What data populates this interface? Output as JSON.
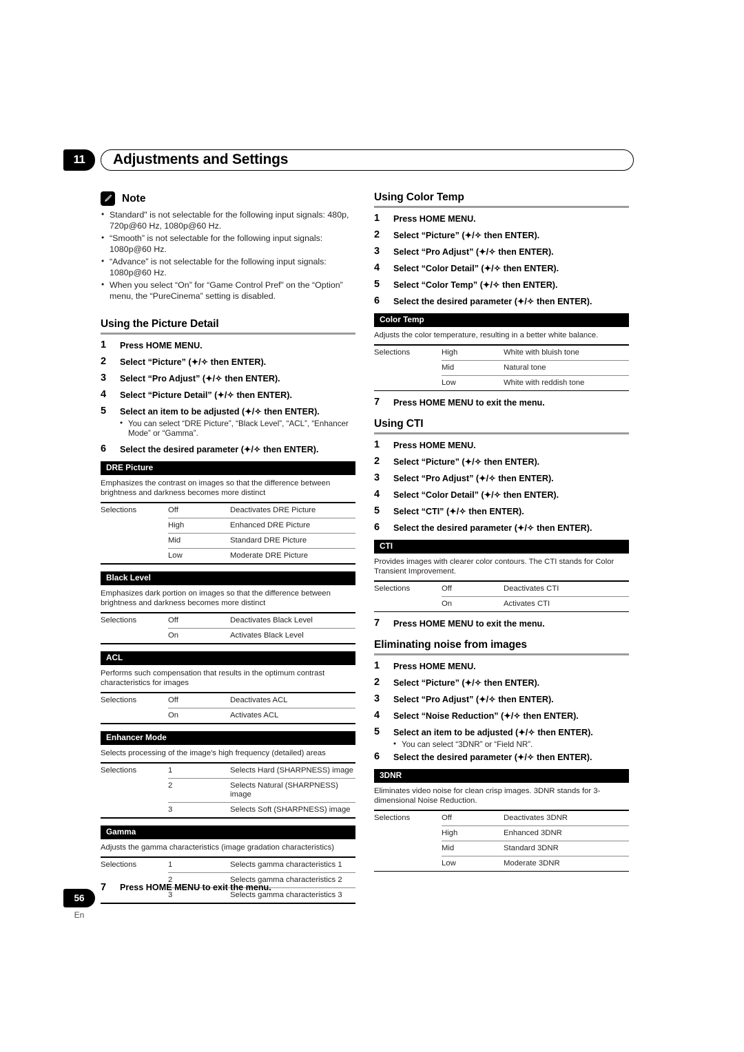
{
  "chapter": {
    "number": "11",
    "title": "Adjustments and Settings"
  },
  "note": {
    "icon": "pencil-note-icon",
    "label": "Note",
    "bullets": [
      "Standard\" is not selectable for the following input signals: 480p, 720p@60 Hz, 1080p@60 Hz.",
      "“Smooth” is not selectable for the following input signals: 1080p@60 Hz.",
      "“Advance” is not selectable for the following input signals: 1080p@60 Hz.",
      "When you select “On” for “Game Control Pref” on the “Option” menu, the “PureCinema” setting is disabled."
    ]
  },
  "sections": {
    "picture_detail": {
      "heading": "Using the Picture Detail",
      "steps": [
        {
          "num": "1",
          "text": "Press HOME MENU."
        },
        {
          "num": "2",
          "text": "Select “Picture” (✦/✧ then ENTER)."
        },
        {
          "num": "3",
          "text": "Select “Pro Adjust” (✦/✧ then ENTER)."
        },
        {
          "num": "4",
          "text": "Select “Picture Detail” (✦/✧ then ENTER)."
        },
        {
          "num": "5",
          "text": "Select an item to be adjusted (✦/✧ then ENTER).",
          "sub": [
            "You can select “DRE Picture”, “Black Level”, “ACL”, “Enhancer Mode” or “Gamma”."
          ]
        },
        {
          "num": "6",
          "text": "Select the desired parameter (✦/✧ then ENTER)."
        }
      ],
      "final_step": {
        "num": "7",
        "text": "Press HOME MENU to exit the menu."
      }
    },
    "color_temp": {
      "heading": "Using Color Temp",
      "steps": [
        {
          "num": "1",
          "text": "Press HOME MENU."
        },
        {
          "num": "2",
          "text": "Select “Picture” (✦/✧ then ENTER)."
        },
        {
          "num": "3",
          "text": "Select “Pro Adjust” (✦/✧ then ENTER)."
        },
        {
          "num": "4",
          "text": "Select “Color Detail” (✦/✧ then ENTER)."
        },
        {
          "num": "5",
          "text": "Select “Color Temp” (✦/✧ then ENTER)."
        },
        {
          "num": "6",
          "text": "Select the desired parameter (✦/✧ then ENTER)."
        }
      ],
      "final_step": {
        "num": "7",
        "text": "Press HOME MENU to exit the menu."
      }
    },
    "cti": {
      "heading": "Using CTI",
      "steps": [
        {
          "num": "1",
          "text": "Press HOME MENU."
        },
        {
          "num": "2",
          "text": "Select “Picture” (✦/✧ then ENTER)."
        },
        {
          "num": "3",
          "text": "Select “Pro Adjust” (✦/✧ then ENTER)."
        },
        {
          "num": "4",
          "text": "Select “Color Detail” (✦/✧ then ENTER)."
        },
        {
          "num": "5",
          "text": "Select “CTI” (✦/✧ then ENTER)."
        },
        {
          "num": "6",
          "text": "Select the desired parameter (✦/✧ then ENTER)."
        }
      ],
      "final_step": {
        "num": "7",
        "text": "Press HOME MENU to exit the menu."
      }
    },
    "noise": {
      "heading": "Eliminating noise from images",
      "steps": [
        {
          "num": "1",
          "text": "Press HOME MENU."
        },
        {
          "num": "2",
          "text": "Select “Picture” (✦/✧ then ENTER)."
        },
        {
          "num": "3",
          "text": "Select “Pro Adjust” (✦/✧ then ENTER)."
        },
        {
          "num": "4",
          "text": "Select “Noise Reduction” (✦/✧ then ENTER)."
        },
        {
          "num": "5",
          "text": "Select an item to be adjusted (✦/✧ then ENTER).",
          "sub": [
            "You can select “3DNR” or “Field NR”."
          ]
        },
        {
          "num": "6",
          "text": "Select the desired parameter (✦/✧ then ENTER)."
        }
      ]
    }
  },
  "tables": {
    "dre_picture": {
      "title": "DRE Picture",
      "description": "Emphasizes the contrast on images so that the difference between brightness and darkness becomes more distinct",
      "selections_label": "Selections",
      "rows": [
        {
          "value": "Off",
          "desc": "Deactivates DRE Picture"
        },
        {
          "value": "High",
          "desc": "Enhanced DRE Picture"
        },
        {
          "value": "Mid",
          "desc": "Standard DRE Picture"
        },
        {
          "value": "Low",
          "desc": "Moderate DRE Picture"
        }
      ]
    },
    "black_level": {
      "title": "Black Level",
      "description": "Emphasizes dark portion on images so that the difference between brightness and darkness becomes more distinct",
      "selections_label": "Selections",
      "rows": [
        {
          "value": "Off",
          "desc": "Deactivates Black Level"
        },
        {
          "value": "On",
          "desc": "Activates Black Level"
        }
      ]
    },
    "acl": {
      "title": "ACL",
      "description": "Performs such compensation that results in the optimum contrast characteristics for images",
      "selections_label": "Selections",
      "rows": [
        {
          "value": "Off",
          "desc": "Deactivates ACL"
        },
        {
          "value": "On",
          "desc": "Activates ACL"
        }
      ]
    },
    "enhancer_mode": {
      "title": "Enhancer Mode",
      "description": "Selects processing of the image's high frequency (detailed) areas",
      "selections_label": "Selections",
      "rows": [
        {
          "value": "1",
          "desc": "Selects Hard (SHARPNESS) image"
        },
        {
          "value": "2",
          "desc": "Selects Natural (SHARPNESS) image"
        },
        {
          "value": "3",
          "desc": "Selects Soft (SHARPNESS) image"
        }
      ]
    },
    "gamma": {
      "title": "Gamma",
      "description": "Adjusts the gamma characteristics (image gradation characteristics)",
      "selections_label": "Selections",
      "rows": [
        {
          "value": "1",
          "desc": "Selects gamma characteristics 1"
        },
        {
          "value": "2",
          "desc": "Selects gamma characteristics 2"
        },
        {
          "value": "3",
          "desc": "Selects gamma characteristics 3"
        }
      ]
    },
    "color_temp": {
      "title": "Color Temp",
      "description": "Adjusts the color temperature, resulting in a better white balance.",
      "selections_label": "Selections",
      "rows": [
        {
          "value": "High",
          "desc": "White with bluish tone"
        },
        {
          "value": "Mid",
          "desc": "Natural tone"
        },
        {
          "value": "Low",
          "desc": "White with reddish tone"
        }
      ]
    },
    "cti": {
      "title": "CTI",
      "description": "Provides images with clearer color contours. The CTI stands for Color Transient Improvement.",
      "selections_label": "Selections",
      "rows": [
        {
          "value": "Off",
          "desc": "Deactivates CTI"
        },
        {
          "value": "On",
          "desc": "Activates CTI"
        }
      ]
    },
    "3dnr": {
      "title": "3DNR",
      "description": "Eliminates video noise for clean crisp images. 3DNR stands for 3-dimensional Noise Reduction.",
      "selections_label": "Selections",
      "rows": [
        {
          "value": "Off",
          "desc": "Deactivates 3DNR"
        },
        {
          "value": "High",
          "desc": "Enhanced 3DNR"
        },
        {
          "value": "Mid",
          "desc": "Standard 3DNR"
        },
        {
          "value": "Low",
          "desc": "Moderate 3DNR"
        }
      ]
    }
  },
  "footer": {
    "page_number": "56",
    "language": "En"
  }
}
